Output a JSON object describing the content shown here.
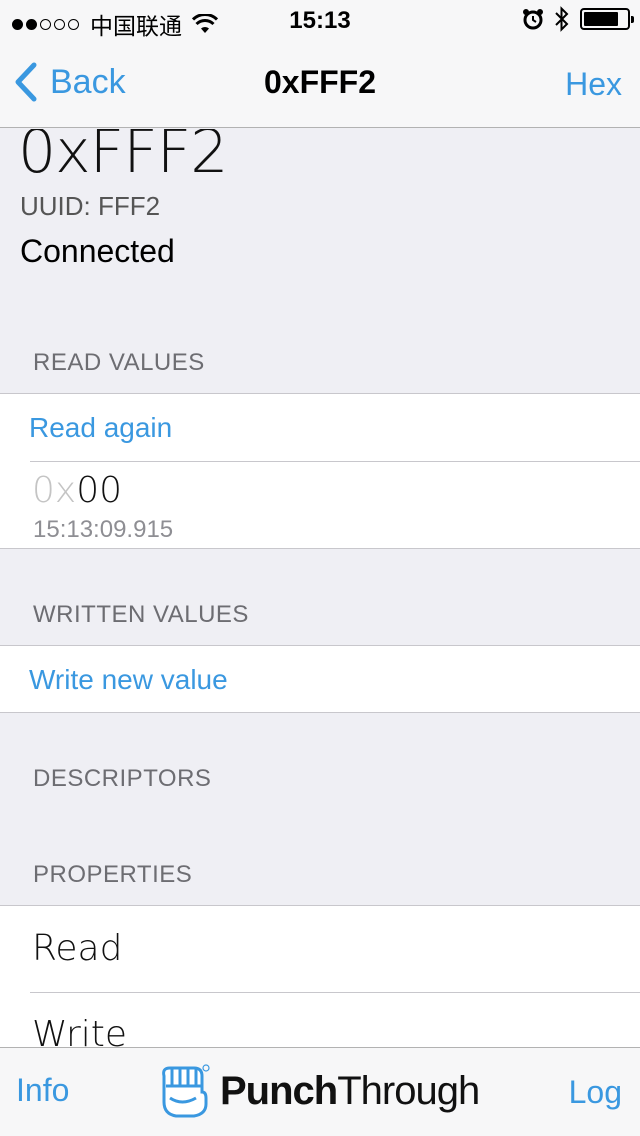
{
  "status_bar": {
    "carrier": "中国联通",
    "time": "15:13"
  },
  "nav": {
    "back_label": "Back",
    "title": "0xFFF2",
    "right_label": "Hex"
  },
  "characteristic": {
    "name": "0xFFF2",
    "uuid": "UUID: FFF2",
    "status": "Connected"
  },
  "read_values": {
    "header": "READ VALUES",
    "action": "Read again",
    "value_prefix": "0x",
    "value_digits": "00",
    "timestamp": "15:13:09.915"
  },
  "written_values": {
    "header": "WRITTEN VALUES",
    "action": "Write new value"
  },
  "descriptors": {
    "header": "DESCRIPTORS"
  },
  "properties": {
    "header": "PROPERTIES",
    "items": [
      "Read",
      "Write"
    ]
  },
  "tab_bar": {
    "left_label": "Info",
    "logo_bold": "Punch",
    "logo_light": "Through",
    "right_label": "Log"
  },
  "colors": {
    "accent": "#3a98e0",
    "background": "#efeff4"
  }
}
